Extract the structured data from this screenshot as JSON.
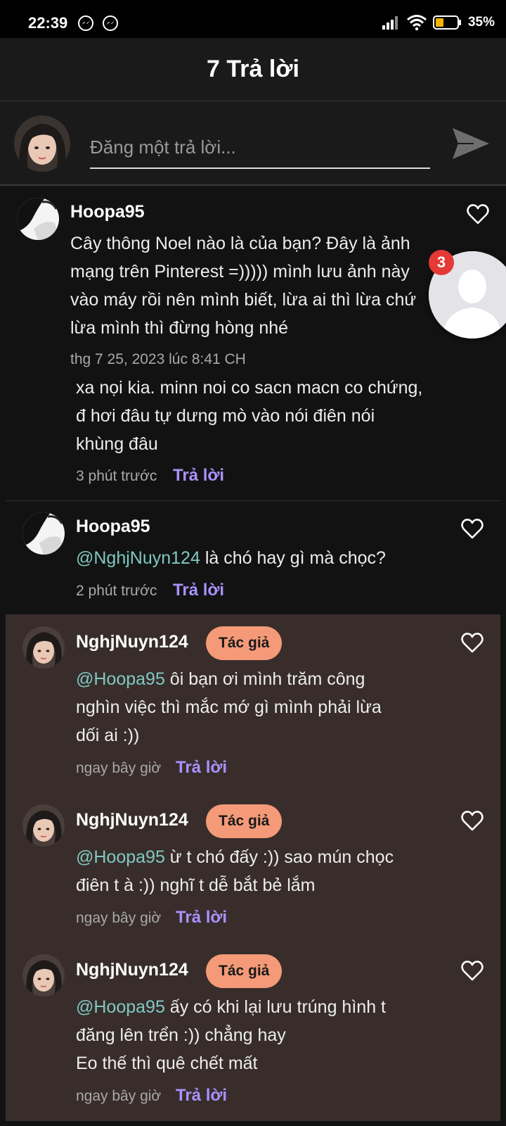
{
  "status_bar": {
    "time": "22:39",
    "battery": "35%"
  },
  "header": {
    "title": "7 Trả lời"
  },
  "compose": {
    "placeholder": "Đăng một trả lời..."
  },
  "floating_bubble": {
    "count": "3"
  },
  "comments": [
    {
      "name": "Hoopa95",
      "text": "Cây thông Noel nào là của bạn? Đây là ảnh mạng trên Pinterest =))))) mình lưu ảnh này vào máy rồi nên mình biết, lừa ai thì lừa chứ lừa mình thì đừng hòng nhé",
      "time": "thg 7 25, 2023 lúc 8:41 CH"
    },
    {
      "text": "xa nọi kia. minn noi co sacn macn co chứng, đ hơi đâu tự dưng mò vào nói điên nói khùng đâu",
      "time": "3 phút trước",
      "reply": "Trả lời"
    },
    {
      "name": "Hoopa95",
      "mention": "@NghjNuyn124",
      "text": " là chó hay gì mà chọc?",
      "time": "2 phút trước",
      "reply": "Trả lời"
    },
    {
      "name": "NghjNuyn124",
      "badge": "Tác giả",
      "mention": "@Hoopa95",
      "text": " ôi bạn ơi mình trăm công nghìn việc thì mắc mớ gì mình phải lừa dối ai :))",
      "time": "ngay bây giờ",
      "reply": "Trả lời"
    },
    {
      "name": "NghjNuyn124",
      "badge": "Tác giả",
      "mention": "@Hoopa95",
      "text": " ừ t chó đấy :)) sao mún chọc điên t à :)) nghĩ t dễ bắt bẻ lắm",
      "time": "ngay bây giờ",
      "reply": "Trả lời"
    },
    {
      "name": "NghjNuyn124",
      "badge": "Tác giả",
      "mention": "@Hoopa95",
      "text": " ấy có khi lại lưu trúng hình t đăng lên trển :)) chẳng hay",
      "text2": "Eo thế thì quê chết mất",
      "time": "ngay bây giờ",
      "reply": "Trả lời"
    }
  ],
  "colors": {
    "background": "#121212",
    "author_background": "#382d2b",
    "mention": "#7fc9c2",
    "reply": "#a892ff",
    "badge": "#f49a78"
  }
}
